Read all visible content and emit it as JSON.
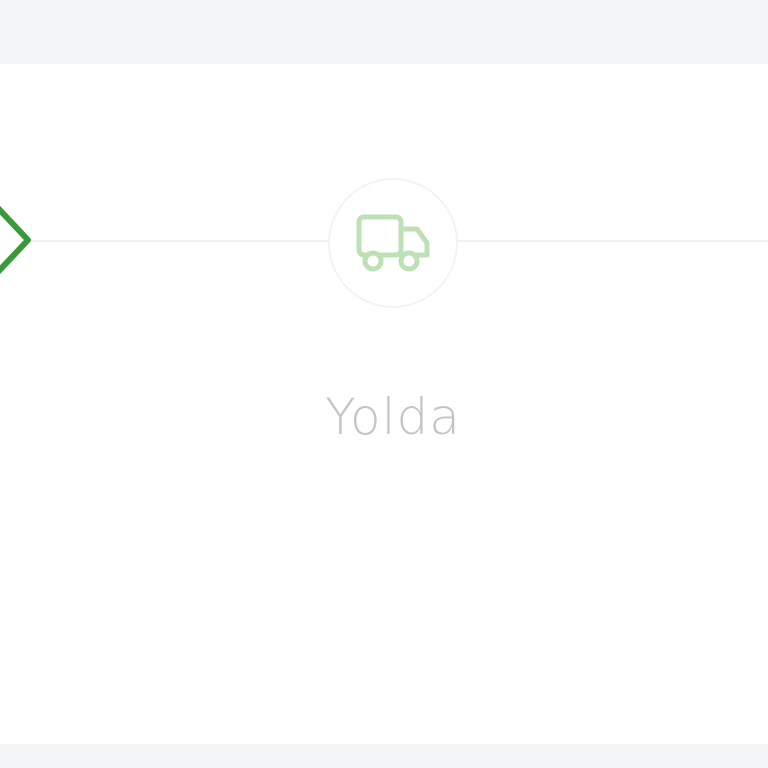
{
  "stepper": {
    "current_step": {
      "label": "Yolda",
      "icon": "truck-icon",
      "status": "pending"
    },
    "previous_step": {
      "icon": "chevron-right-icon",
      "status": "completed"
    }
  },
  "colors": {
    "completed_accent": "#3a9a3a",
    "pending_icon": "#bde0b4",
    "pending_text": "#c4c4c4",
    "connector": "#f1f1f1",
    "background": "#f4f5f7",
    "card": "#ffffff"
  }
}
